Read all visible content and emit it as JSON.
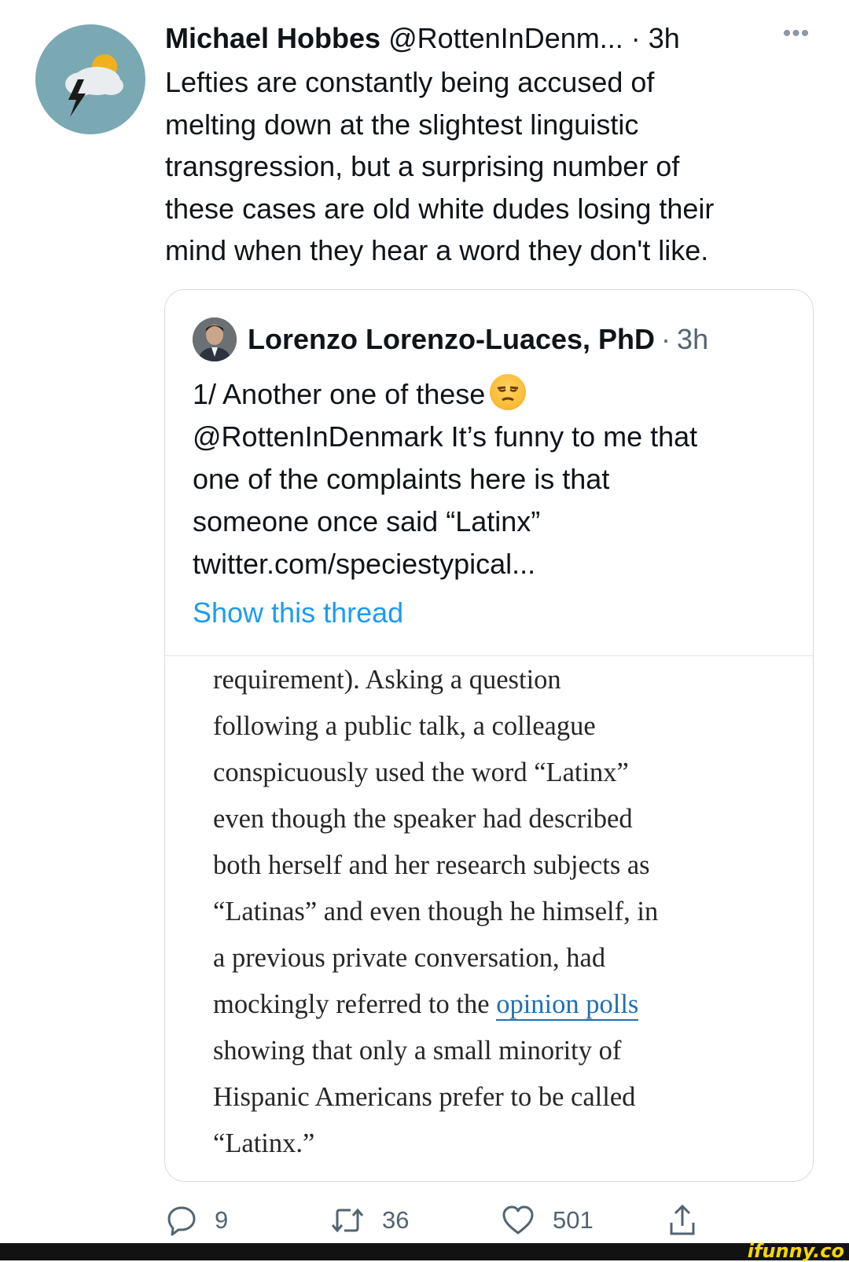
{
  "tweet": {
    "author_name": "Michael Hobbes",
    "author_handle": "@RottenInDenm...",
    "separator": "·",
    "time": "3h",
    "more": "•••",
    "text_lines": [
      "Lefties are constantly being accused of",
      "melting down at the slightest linguistic",
      "transgression, but a surprising number of",
      "these cases are old white dudes losing their",
      "mind when they hear a word they don't like."
    ]
  },
  "quote": {
    "author_name": "Lorenzo Lorenzo-Luaces, PhD",
    "separator": "·",
    "time": "3h",
    "text_lines": [
      "1/ Another one of these",
      "@RottenInDenmark It’s funny to me that",
      "one of the complaints here is that",
      "someone once said “Latinx”",
      "twitter.com/speciestypical..."
    ],
    "show_thread": "Show this thread",
    "article": {
      "line1": "requirement). Asking a question",
      "line2": "following a public talk, a colleague",
      "line3": "conspicuously used the word “Latinx”",
      "line4": "even though the speaker had described",
      "line5": "both herself and her research subjects as",
      "line6": "“Latinas” and even though he himself, in",
      "line7": "a previous private conversation, had",
      "line8_pre": "mockingly referred to the ",
      "line8_link": "opinion polls",
      "line9": "showing that only a small minority of",
      "line10": "Hispanic Americans prefer to be called",
      "line11": "“Latinx.”"
    }
  },
  "actions": {
    "replies": "9",
    "retweets": "36",
    "likes": "501"
  },
  "watermark": "ifunny.co"
}
